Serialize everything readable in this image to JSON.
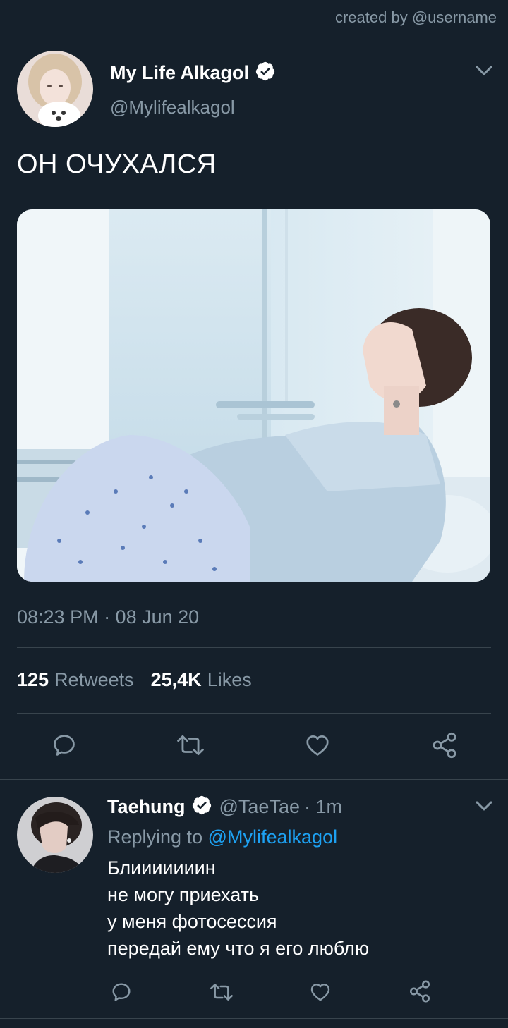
{
  "watermark": "created by @username",
  "main_tweet": {
    "display_name": "My Life Alkagol",
    "handle": "@Mylifealkagol",
    "text": "ОН ОЧУХАЛСЯ",
    "timestamp": "08:23 PM · 08 Jun 20",
    "retweets_count": "125",
    "retweets_label": "Retweets",
    "likes_count": "25,4K",
    "likes_label": "Likes",
    "verified": true
  },
  "reply": {
    "display_name": "Taehung",
    "handle": "@TaeTae",
    "time": "· 1m",
    "replying_to_label": "Replying to",
    "replying_to_handle": "@Mylifealkagol",
    "lines": [
      "Блииииииин",
      "не могу приехать",
      "у меня фотосессия",
      "передай ему что я его люблю"
    ],
    "verified": true
  },
  "icons": [
    "chevron-down-icon",
    "verified-icon",
    "reply-icon",
    "retweet-icon",
    "like-icon",
    "share-icon"
  ],
  "colors": {
    "background": "#15202b",
    "divider": "#38444d",
    "secondary_text": "#8899a6",
    "link": "#1da1f2"
  }
}
